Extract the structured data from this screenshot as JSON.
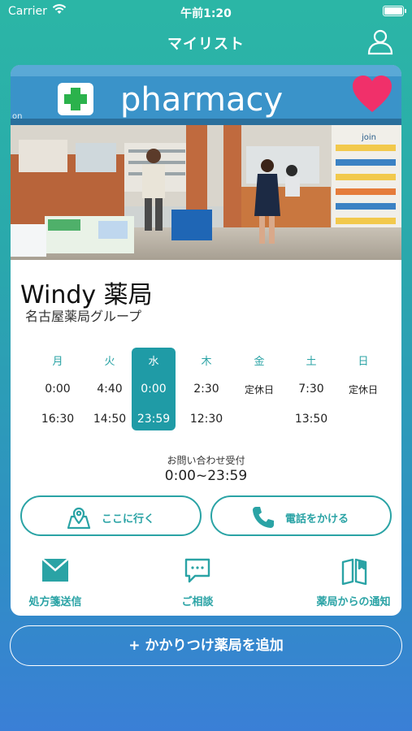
{
  "status_bar": {
    "carrier": "Carrier",
    "time": "午前1:20"
  },
  "nav": {
    "title": "マイリスト",
    "profile_icon": "person-icon"
  },
  "card": {
    "photo": {
      "sign_text": "pharmacy",
      "sign_small": "on",
      "store_text": "join"
    },
    "favorite_icon": "heart-icon",
    "favorite_color": "#f0306a",
    "name": "Windy 薬局",
    "group": "名古屋薬局グループ",
    "hours": [
      {
        "day": "月",
        "open": "0:00",
        "close": "16:30",
        "today": false
      },
      {
        "day": "火",
        "open": "4:40",
        "close": "14:50",
        "today": false
      },
      {
        "day": "水",
        "open": "0:00",
        "close": "23:59",
        "today": true
      },
      {
        "day": "木",
        "open": "2:30",
        "close": "12:30",
        "today": false
      },
      {
        "day": "金",
        "open": "定休日",
        "close": "",
        "today": false
      },
      {
        "day": "土",
        "open": "7:30",
        "close": "13:50",
        "today": false
      },
      {
        "day": "日",
        "open": "定休日",
        "close": "",
        "today": false
      }
    ],
    "contact_label": "お問い合わせ受付",
    "contact_time": "0:00~23:59",
    "go_button": {
      "label": "ここに行く",
      "icon": "map-pin-icon"
    },
    "call_button": {
      "label": "電話をかける",
      "icon": "phone-icon"
    },
    "quick_actions": [
      {
        "label": "処方箋送信",
        "icon": "envelope-icon"
      },
      {
        "label": "ご相談",
        "icon": "chat-bubble-icon"
      },
      {
        "label": "薬局からの通知",
        "icon": "book-icon"
      }
    ]
  },
  "add_button": {
    "plus": "+",
    "label": "かかりつけ薬局を追加"
  },
  "colors": {
    "accent": "#2aa3a5",
    "today_bg": "#1f9ba6"
  }
}
